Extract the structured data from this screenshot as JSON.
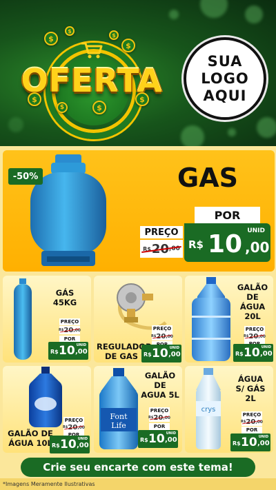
{
  "header": {
    "banner_text": "OFERTA",
    "logo_lines": [
      "SUA",
      "LOGO",
      "AQUI"
    ],
    "coin_symbol": "$",
    "brand_green": "#1a6b24",
    "brand_yellow": "#ffc21a"
  },
  "hero": {
    "discount": "-50%",
    "title": "GAS",
    "por_label": "POR",
    "preco_label": "PREÇO",
    "old_price": {
      "currency": "R$",
      "int": "20",
      "cents": ",00"
    },
    "new_price": {
      "currency": "R$",
      "int": "10",
      "cents": ",00",
      "unit": "UNID"
    },
    "image_icon": "gas-cylinder-icon"
  },
  "products": [
    {
      "title_lines": [
        "GÁS",
        "45KG"
      ],
      "icon": "tall-gas-cylinder-icon",
      "preco_label": "PREÇO",
      "por_label": "POR",
      "old_price": {
        "currency": "R$",
        "int": "20",
        "cents": ",00"
      },
      "new_price": {
        "currency": "R$",
        "int": "10",
        "cents": ",00",
        "unit": "UNID"
      }
    },
    {
      "title_lines": [
        "REGULADOR",
        "DE GAS"
      ],
      "icon": "gas-regulator-icon",
      "preco_label": "PREÇO",
      "por_label": "POR",
      "old_price": {
        "currency": "R$",
        "int": "20",
        "cents": ",00"
      },
      "new_price": {
        "currency": "R$",
        "int": "10",
        "cents": ",00",
        "unit": "UNID"
      }
    },
    {
      "title_lines": [
        "GALÃO",
        "DE",
        "ÁGUA",
        "20L"
      ],
      "icon": "water-jug-20l-icon",
      "preco_label": "PREÇO",
      "por_label": "POR",
      "old_price": {
        "currency": "R$",
        "int": "20",
        "cents": ",00"
      },
      "new_price": {
        "currency": "R$",
        "int": "10",
        "cents": ",00",
        "unit": "UNID"
      }
    },
    {
      "title_lines": [
        "GALÃO DE",
        "ÁGUA 10L"
      ],
      "icon": "water-jug-10l-icon",
      "preco_label": "PREÇO",
      "por_label": "POR",
      "old_price": {
        "currency": "R$",
        "int": "20",
        "cents": ",00"
      },
      "new_price": {
        "currency": "R$",
        "int": "10",
        "cents": ",00",
        "unit": "UNID"
      }
    },
    {
      "title_lines": [
        "GALÃO",
        "DE",
        "AGUA 5L"
      ],
      "icon": "water-bottle-5l-icon",
      "bottle_brand": [
        "Font",
        "Life"
      ],
      "preco_label": "PREÇO",
      "por_label": "POR",
      "old_price": {
        "currency": "R$",
        "int": "20",
        "cents": ",00"
      },
      "new_price": {
        "currency": "R$",
        "int": "10",
        "cents": ",00",
        "unit": "UNID"
      }
    },
    {
      "title_lines": [
        "ÁGUA",
        "S/ GÁS",
        "2L"
      ],
      "icon": "water-bottle-2l-icon",
      "bottle_brand": [
        "crys"
      ],
      "preco_label": "PREÇO",
      "por_label": "POR",
      "old_price": {
        "currency": "R$",
        "int": "20",
        "cents": ",00"
      },
      "new_price": {
        "currency": "R$",
        "int": "10",
        "cents": ",00",
        "unit": "UNID"
      }
    }
  ],
  "footer": {
    "cta": "Crie seu encarte com este tema!",
    "disclaimer": "*Imagens Meramente Ilustrativas"
  }
}
